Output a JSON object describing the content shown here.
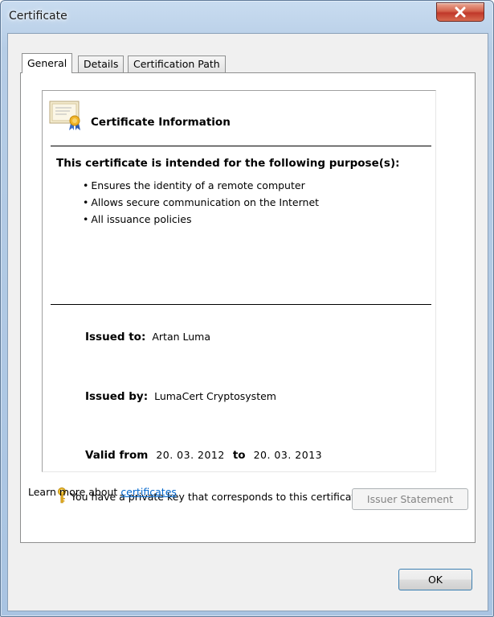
{
  "window": {
    "title": "Certificate",
    "close_glyph": "x-icon"
  },
  "tabs": [
    {
      "label": "General",
      "active": true
    },
    {
      "label": "Details",
      "active": false
    },
    {
      "label": "Certification Path",
      "active": false
    }
  ],
  "info": {
    "title": "Certificate Information",
    "purpose_heading": "This certificate is intended for the following purpose(s):",
    "purposes": [
      "Ensures the identity of a remote computer",
      "Allows secure communication on the Internet",
      "All issuance policies"
    ],
    "issued_to_label": "Issued to:",
    "issued_to": "Artan Luma",
    "issued_by_label": "Issued by:",
    "issued_by": "LumaCert Cryptosystem",
    "valid_from_label": "Valid from",
    "valid_from": "20. 03. 2012",
    "valid_to_label": "to",
    "valid_to": "20. 03. 2013",
    "private_key_note": "You have a private key that corresponds to this certificate."
  },
  "buttons": {
    "issuer_statement": "Issuer Statement",
    "ok": "OK"
  },
  "learn_more": {
    "prefix": "Learn more about",
    "link": "certificates"
  },
  "colors": {
    "link": "#0066cc",
    "close_button": "#c0382a",
    "disabled_text": "#838383"
  }
}
